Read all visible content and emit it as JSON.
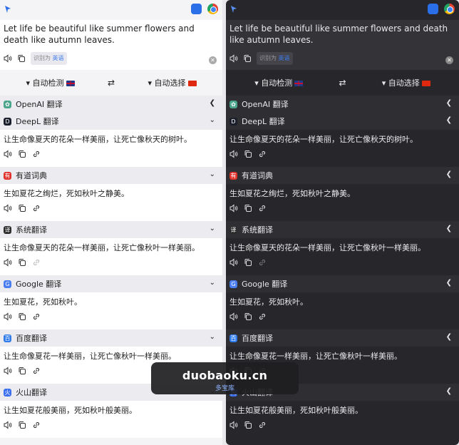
{
  "source_text": "Let life be beautiful like summer flowers and death like autumn leaves.",
  "detected_prefix": "识别为",
  "detected_lang": "英语",
  "lang_from": "自动检测",
  "lang_to": "自动选择",
  "openai_name": "OpenAI 翻译",
  "services": [
    {
      "name": "DeepL 翻译",
      "text": "让生命像夏天的花朵一样美丽，让死亡像秋天的树叶。",
      "color": "#1b1e2b",
      "glyph": "D"
    },
    {
      "name": "有道词典",
      "text": "生如夏花之绚烂，死如秋叶之静美。",
      "color": "#e0312b",
      "glyph": "有"
    },
    {
      "name": "系统翻译",
      "text": "让生命像夏天的花朵一样美丽，让死亡像秋叶一样美丽。",
      "color": "#2b2b2b",
      "glyph": "译"
    },
    {
      "name": "Google 翻译",
      "text": "生如夏花，死如秋叶。",
      "color": "#4a7ef0",
      "glyph": "G"
    },
    {
      "name": "百度翻译",
      "text": "让生命像夏花一样美丽，让死亡像秋叶一样美丽。",
      "color": "#2f7bea",
      "glyph": "百"
    },
    {
      "name": "火山翻译",
      "text": "让生如夏花般美丽，死如秋叶般美丽。",
      "color": "#3b6ff0",
      "glyph": "火"
    }
  ],
  "watermark": {
    "site": "duobaoku.cn",
    "sub": "多宝库"
  }
}
